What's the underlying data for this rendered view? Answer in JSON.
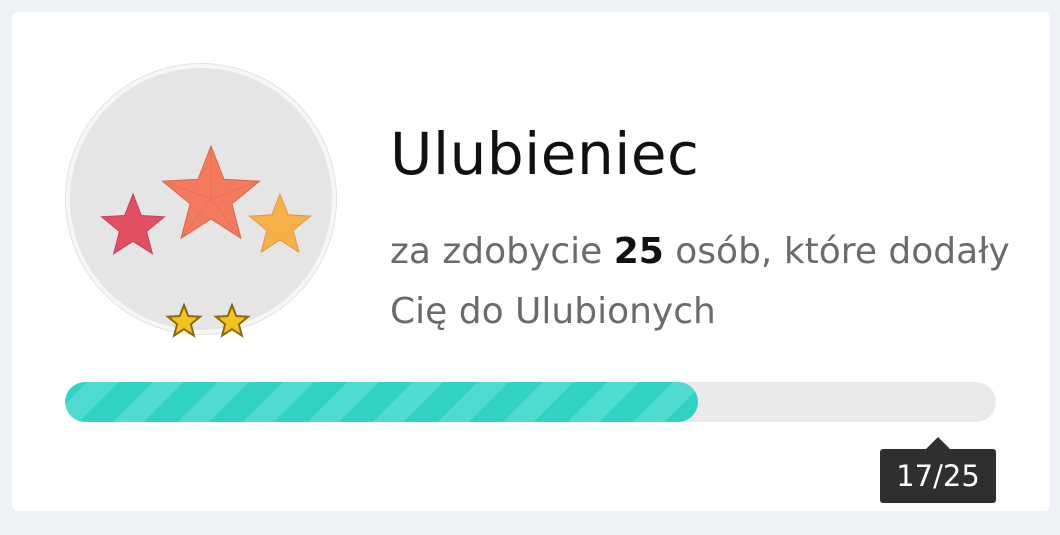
{
  "achievement": {
    "title": "Ulubieniec",
    "description_prefix": "za zdobycie ",
    "goal": "25",
    "description_suffix": " osób, które dodały Cię do Ulubionych",
    "badge_icon": "three-stars-icon",
    "level_icons": [
      "gold-star-icon",
      "gold-star-icon"
    ],
    "level": 2
  },
  "progress": {
    "current": 17,
    "total": 25,
    "label": "17/25",
    "fraction": 0.68
  },
  "colors": {
    "progress_fill": "#2fd2c3",
    "progress_track": "#eaeaea",
    "star_left": "#e24e62",
    "star_center": "#f37a5c",
    "star_right": "#f5b04a",
    "tooltip_bg": "#2f2f2f"
  }
}
